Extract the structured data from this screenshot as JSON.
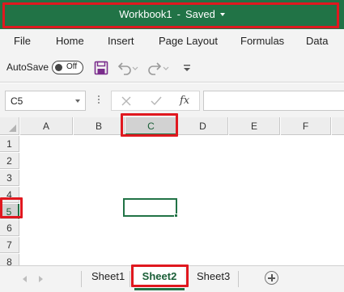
{
  "titlebar": {
    "workbook_name": "Workbook1",
    "separator": "-",
    "save_status": "Saved",
    "accent": "#217346"
  },
  "menu": {
    "items": [
      {
        "label": "File"
      },
      {
        "label": "Home"
      },
      {
        "label": "Insert"
      },
      {
        "label": "Page Layout"
      },
      {
        "label": "Formulas"
      },
      {
        "label": "Data"
      }
    ]
  },
  "quick_access": {
    "autosave_label": "AutoSave",
    "autosave_state": "Off",
    "icons": [
      "save-icon",
      "undo-icon",
      "redo-icon",
      "customize-qat-icon"
    ]
  },
  "formula_bar": {
    "name_box_value": "C5",
    "fx_label": "fx",
    "formula_value": ""
  },
  "grid": {
    "columns": [
      "A",
      "B",
      "C",
      "D",
      "E",
      "F"
    ],
    "rows": [
      "1",
      "2",
      "3",
      "4",
      "5",
      "6",
      "7",
      "8"
    ],
    "selected_column": "C",
    "selected_row": "5",
    "active_cell": "C5"
  },
  "sheets": {
    "tabs": [
      {
        "label": "Sheet1"
      },
      {
        "label": "Sheet2"
      },
      {
        "label": "Sheet3"
      }
    ],
    "active": "Sheet2"
  },
  "highlight_color": "#e0181f"
}
